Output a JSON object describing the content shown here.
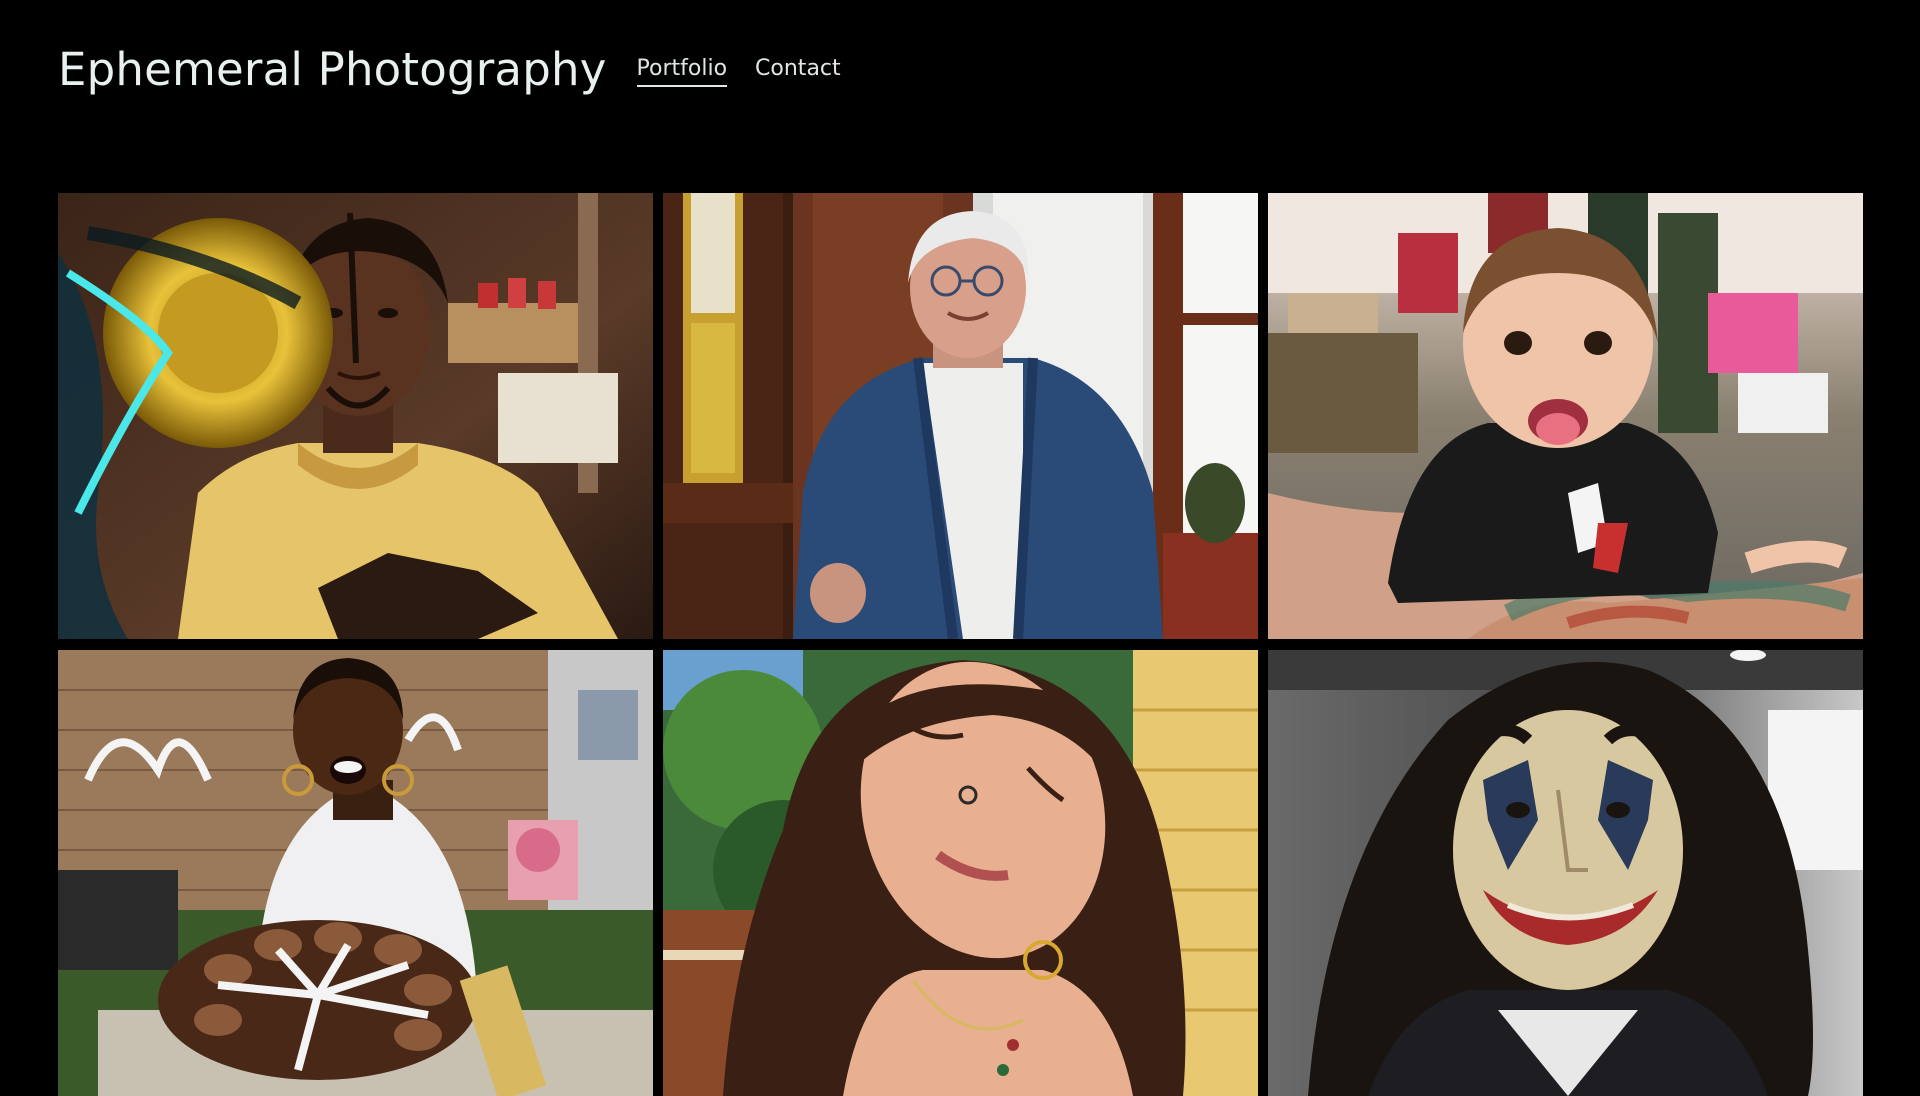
{
  "site": {
    "title": "Ephemeral Photography"
  },
  "nav": {
    "items": [
      {
        "label": "Portfolio",
        "active": true
      },
      {
        "label": "Contact",
        "active": false
      }
    ]
  },
  "colors": {
    "background": "#000000",
    "text": "#e9f0f0"
  },
  "gallery": {
    "photos": [
      {
        "subject": "young man in yellow t-shirt beside gold and teal paper decoration"
      },
      {
        "subject": "elderly man with glasses in blue jacket standing by window"
      },
      {
        "subject": "toddler sticking out tongue held by tattooed arm at outdoor party"
      },
      {
        "subject": "woman with hoop earrings over cake at baby shower"
      },
      {
        "subject": "woman with nose ring, eyes closed, in sunlight"
      },
      {
        "subject": "person in clown face paint with curly dark hair"
      }
    ]
  }
}
